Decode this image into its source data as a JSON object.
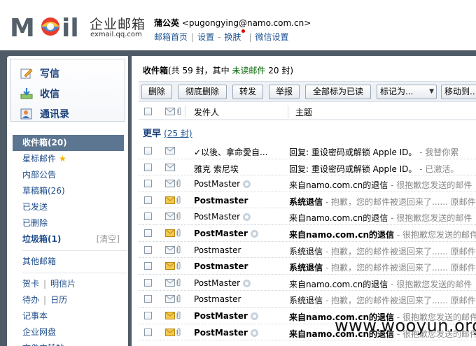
{
  "header": {
    "logo_text": "MOil",
    "logo_cn": "企业邮箱",
    "logo_sub": "exmail.qq.com",
    "user_name": "蒲公英",
    "user_email": "<pugongying@namo.com.cn>",
    "links": [
      "邮箱首页",
      "设置",
      "换肤",
      "微信设置"
    ]
  },
  "sidebar": {
    "actions": [
      {
        "label": "写信",
        "icon": "compose-icon"
      },
      {
        "label": "收信",
        "icon": "receive-icon"
      },
      {
        "label": "通讯录",
        "icon": "contacts-icon"
      }
    ],
    "folders": [
      {
        "label": "收件箱(20)",
        "selected": true
      },
      {
        "label": "星标邮件"
      },
      {
        "label": "内部公告"
      },
      {
        "label": "草稿箱(26)"
      },
      {
        "label": "已发送"
      },
      {
        "label": "已删除"
      },
      {
        "label": "垃圾箱(1)",
        "extra": "[清空]"
      }
    ],
    "other": "其他邮箱",
    "tools": [
      [
        "贺卡",
        "明信片"
      ],
      [
        "待办",
        "日历"
      ]
    ],
    "notebook": "记事本",
    "disk": "企业网盘",
    "transfer": "文件中转站"
  },
  "main": {
    "title": "收件箱",
    "summary_pre": "(共 59 封，其中 ",
    "unread_label": "未读邮件",
    "summary_post": " 20 封)",
    "toolbar": {
      "delete": "删除",
      "delete_forever": "彻底删除",
      "forward": "转发",
      "report": "举报",
      "mark_all_read": "全部标为已读",
      "mark_as": "标记为...",
      "move_to": "移动到..."
    },
    "columns": {
      "from": "发件人",
      "subject": "主题"
    },
    "group": {
      "label": "更早",
      "count": "(25 封)"
    },
    "rows": [
      {
        "from": "✓以後、拿命愛自...",
        "subject": "回复: 重设密码或解锁 Apple ID。",
        "preview": " - 我替你累",
        "unread": false,
        "clip": false,
        "qq": false
      },
      {
        "from": "雅克 索尼埃",
        "subject": "回复: 重设密码或解锁 Apple ID。",
        "preview": " - 已激活。",
        "unread": false,
        "clip": false,
        "qq": false
      },
      {
        "from": "PostMaster",
        "subject": "来自namo.com.cn的退信",
        "preview": " - 很抱歉您发送的邮件",
        "unread": false,
        "clip": true,
        "qq": true
      },
      {
        "from": "Postmaster",
        "subject": "系统退信",
        "preview": " - 抱歉，您的邮件被退回来了...... 原邮件",
        "unread": true,
        "clip": true,
        "qq": false
      },
      {
        "from": "PostMaster",
        "subject": "来自namo.com.cn的退信",
        "preview": " - 很抱歉您发送的邮件",
        "unread": false,
        "clip": true,
        "qq": true
      },
      {
        "from": "PostMaster",
        "subject": "来自namo.com.cn的退信",
        "preview": " - 很抱歉您发送的邮件",
        "unread": true,
        "clip": true,
        "qq": true
      },
      {
        "from": "Postmaster",
        "subject": "系统退信",
        "preview": " - 抱歉，您的邮件被退回来了...... 原邮件",
        "unread": false,
        "clip": true,
        "qq": false
      },
      {
        "from": "Postmaster",
        "subject": "系统退信",
        "preview": " - 抱歉，您的邮件被退回来了...... 原邮件",
        "unread": true,
        "clip": true,
        "qq": false
      },
      {
        "from": "PostMaster",
        "subject": "来自namo.com.cn的退信",
        "preview": " - 很抱歉您发送的邮件",
        "unread": false,
        "clip": true,
        "qq": true
      },
      {
        "from": "Postmaster",
        "subject": "系统退信",
        "preview": " - 抱歉，您的邮件被退回来了...... 原邮件",
        "unread": false,
        "clip": true,
        "qq": false
      },
      {
        "from": "PostMaster",
        "subject": "来自namo.com.cn的退信",
        "preview": " - 很抱歉您发送的邮件",
        "unread": true,
        "clip": true,
        "qq": true
      },
      {
        "from": "PostMaster",
        "subject": "来自namo.com.cn的退信",
        "preview": " - 很抱歉您发送的邮件",
        "unread": true,
        "clip": true,
        "qq": true
      }
    ]
  },
  "watermark": "www.wooyun.org",
  "colors": {
    "accent": "#5c7591",
    "frame": "#4e5b67",
    "link": "#1e5494",
    "unread": "#006600"
  }
}
